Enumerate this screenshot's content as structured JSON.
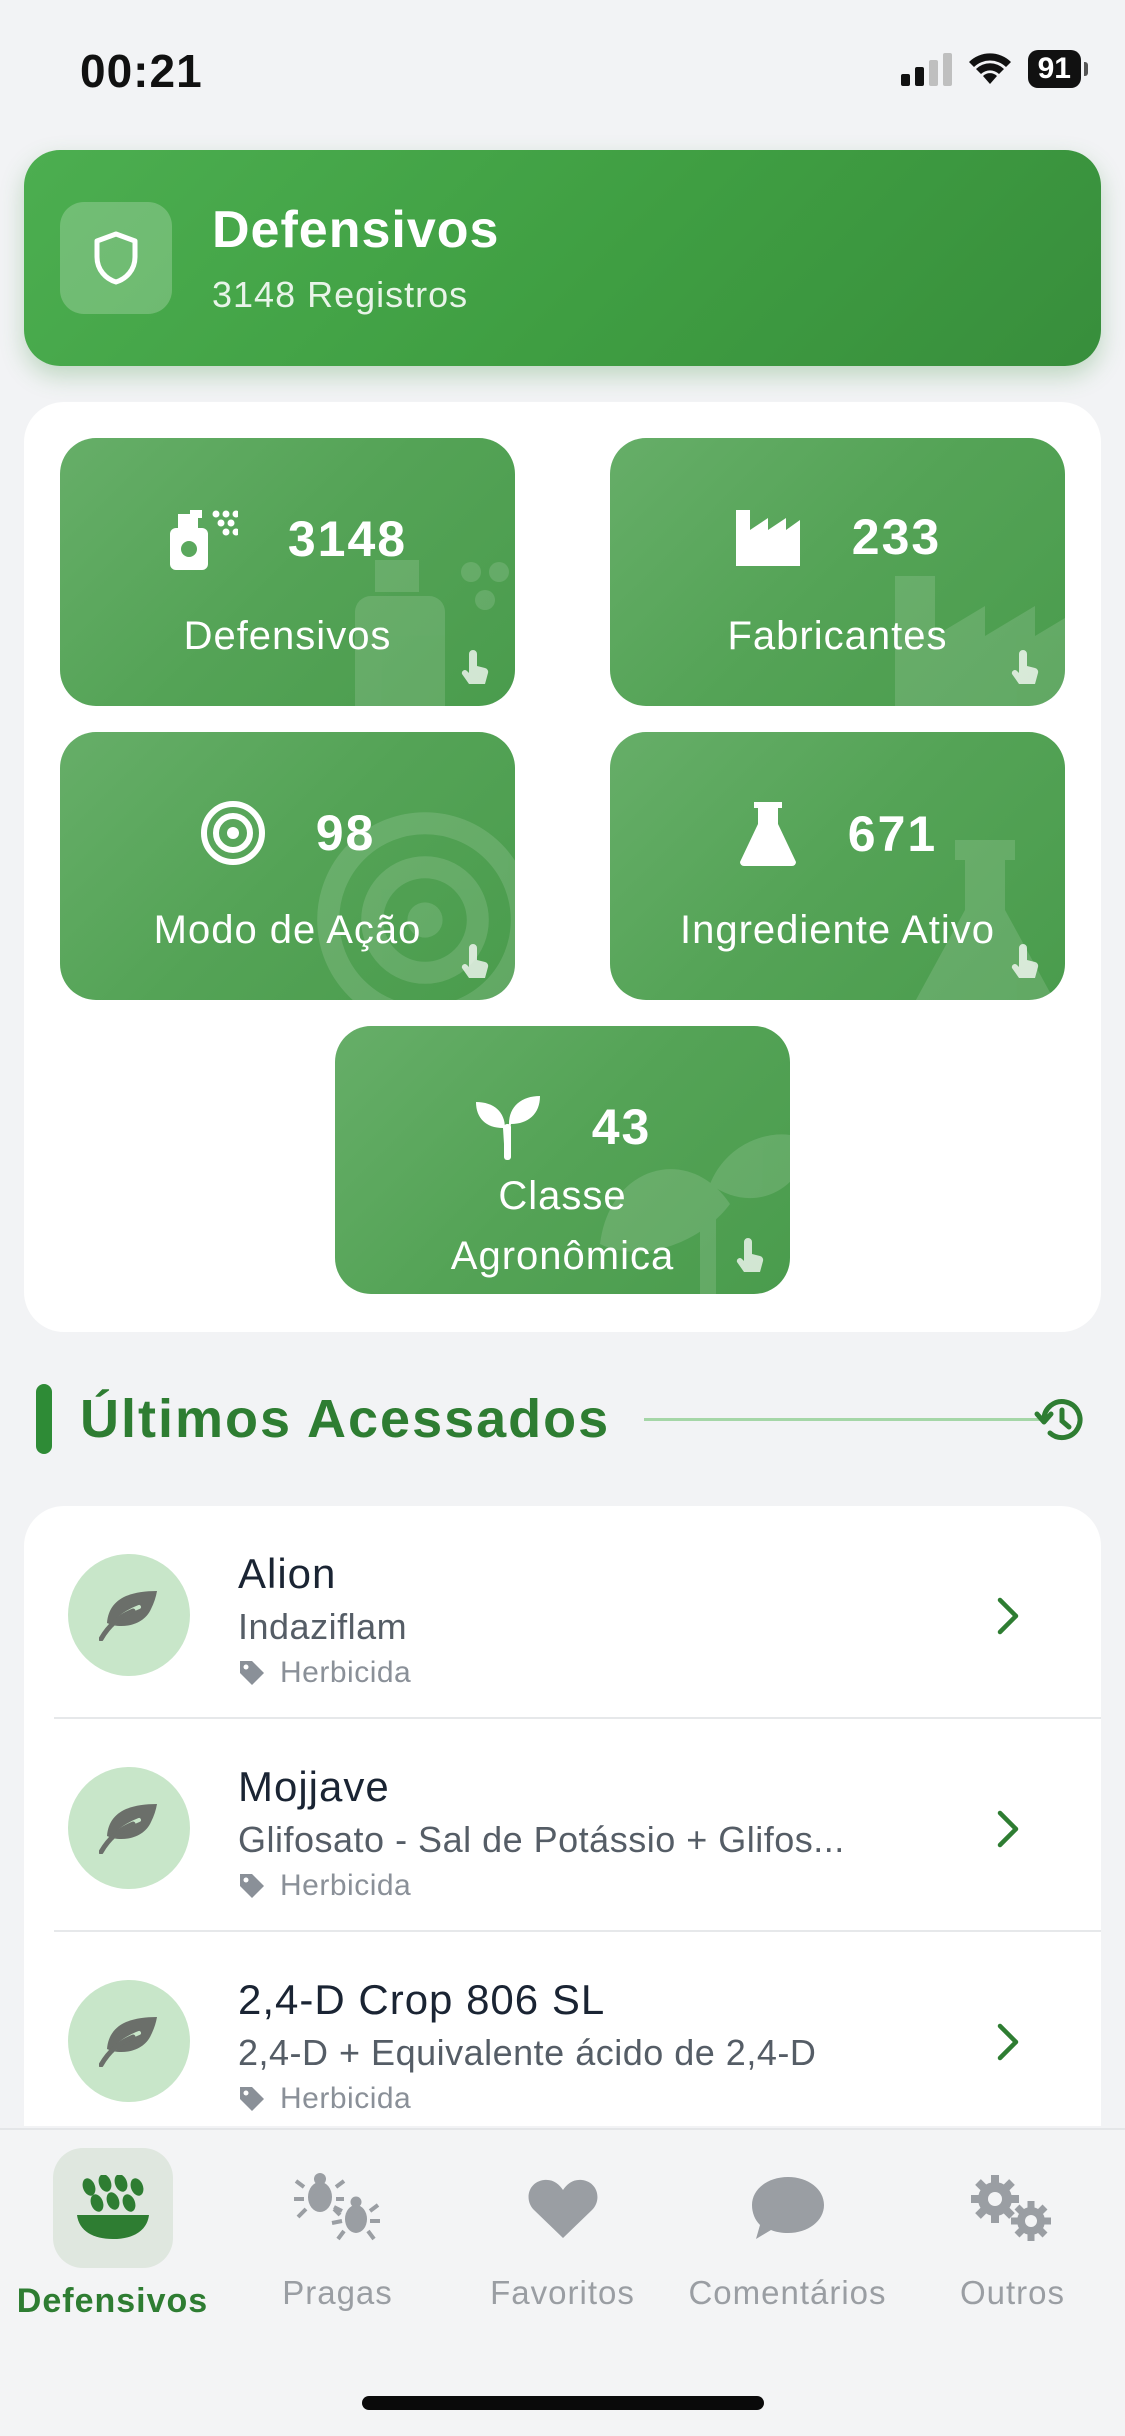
{
  "status_bar": {
    "time": "00:21",
    "battery": "91"
  },
  "header": {
    "title": "Defensivos",
    "subtitle": "3148 Registros"
  },
  "stats": [
    {
      "count": "3148",
      "label": "Defensivos",
      "icon": "spray-bottle-icon"
    },
    {
      "count": "233",
      "label": "Fabricantes",
      "icon": "factory-icon"
    },
    {
      "count": "98",
      "label": "Modo de Ação",
      "icon": "target-icon"
    },
    {
      "count": "671",
      "label": "Ingrediente Ativo",
      "icon": "flask-icon"
    },
    {
      "count": "43",
      "label_line1": "Classe",
      "label_line2": "Agronômica",
      "icon": "sprout-icon"
    }
  ],
  "recent": {
    "title": "Últimos Acessados",
    "items": [
      {
        "name": "Alion",
        "ingredient": "Indaziflam",
        "category": "Herbicida"
      },
      {
        "name": "Mojjave",
        "ingredient": "Glifosato - Sal de Potássio + Glifos...",
        "category": "Herbicida"
      },
      {
        "name": "2,4-D Crop 806 SL",
        "ingredient": "2,4-D + Equivalente ácido de 2,4-D",
        "category": "Herbicida"
      }
    ]
  },
  "nav": [
    {
      "label": "Defensivos",
      "active": true
    },
    {
      "label": "Pragas"
    },
    {
      "label": "Favoritos"
    },
    {
      "label": "Comentários"
    },
    {
      "label": "Outros"
    }
  ],
  "colors": {
    "primary": "#388e3c",
    "accent_text": "#2e7d32",
    "tile": "#54a356",
    "avatar_bg": "#c8e6c9"
  }
}
